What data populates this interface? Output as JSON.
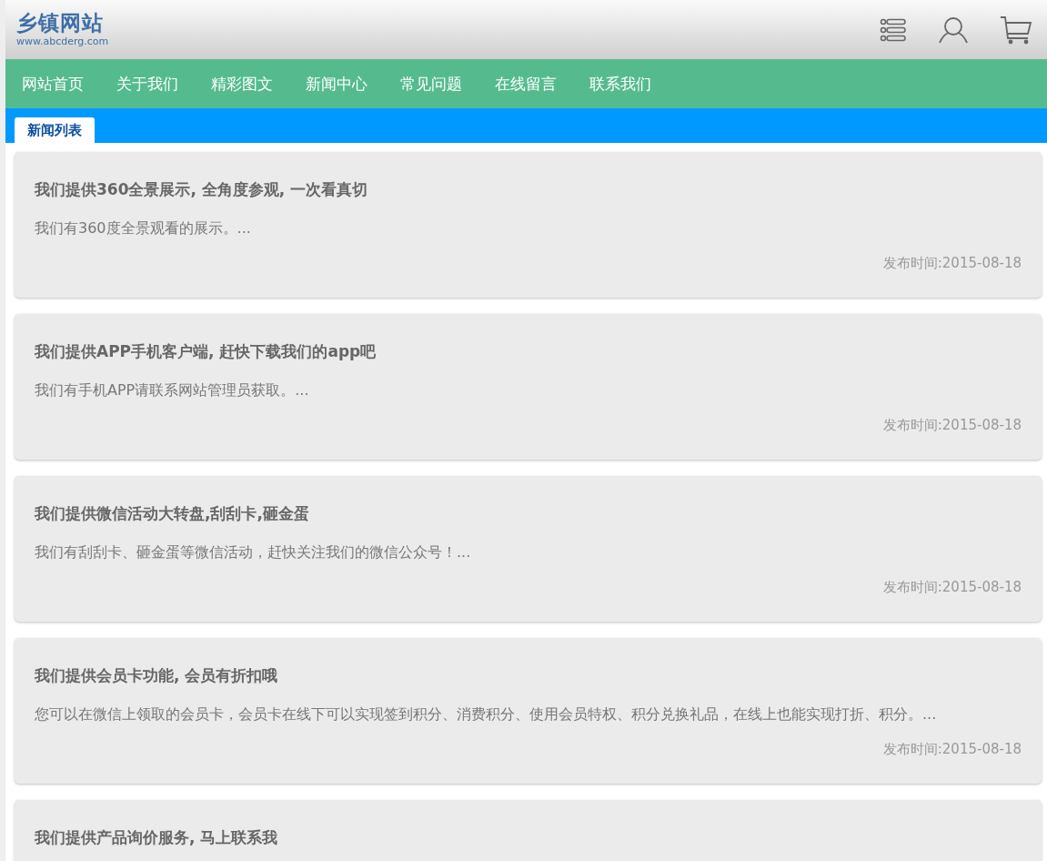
{
  "logo": {
    "title": "乡镇网站",
    "url": "www.abcderg.com"
  },
  "nav": [
    "网站首页",
    "关于我们",
    "精彩图文",
    "新闻中心",
    "常见问题",
    "在线留言",
    "联系我们"
  ],
  "section_tab": {
    "label": "新闻列表",
    "selected": true
  },
  "news": [
    {
      "title": "我们提供360全景展示, 全角度参观, 一次看真切",
      "summary": "我们有360度全景观看的展示。...",
      "date": "发布时间:2015-08-18"
    },
    {
      "title": "我们提供APP手机客户端, 赶快下载我们的app吧",
      "summary": "我们有手机APP请联系网站管理员获取。...",
      "date": "发布时间:2015-08-18"
    },
    {
      "title": "我们提供微信活动大转盘,刮刮卡,砸金蛋",
      "summary": "我们有刮刮卡、砸金蛋等微信活动，赶快关注我们的微信公众号！...",
      "date": "发布时间:2015-08-18"
    },
    {
      "title": "我们提供会员卡功能, 会员有折扣哦",
      "summary": "您可以在微信上领取的会员卡，会员卡在线下可以实现签到积分、消费积分、使用会员特权、积分兑换礼品，在线上也能实现打折、积分。...",
      "date": "发布时间:2015-08-18"
    },
    {
      "title": "我们提供产品询价服务, 马上联系我"
    }
  ]
}
